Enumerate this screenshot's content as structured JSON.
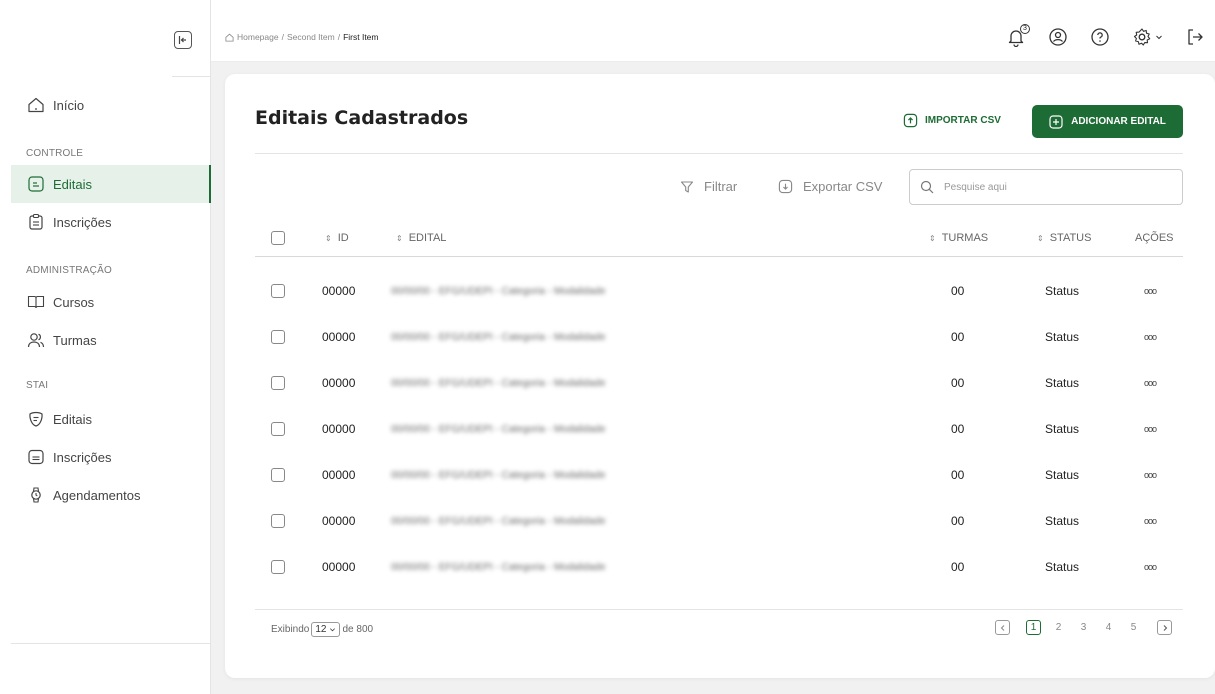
{
  "sidebar": {
    "items": [
      {
        "label": "Início",
        "icon": "home-icon"
      },
      {
        "label": "Editais",
        "icon": "document-icon",
        "active": true
      },
      {
        "label": "Inscrições",
        "icon": "clipboard-icon"
      },
      {
        "label": "Cursos",
        "icon": "book-icon"
      },
      {
        "label": "Turmas",
        "icon": "users-icon"
      },
      {
        "label": "Editais",
        "icon": "face-icon"
      },
      {
        "label": "Inscrições",
        "icon": "inbox-icon"
      },
      {
        "label": "Agendamentos",
        "icon": "watch-icon"
      }
    ],
    "sections": [
      "CONTROLE",
      "ADMINISTRAÇÃO",
      "STAI"
    ]
  },
  "breadcrumb": [
    "Homepage",
    "Second Item",
    "First Item"
  ],
  "notifications_count": "3",
  "page": {
    "title": "Editais Cadastrados",
    "import_label": "IMPORTAR CSV",
    "add_label": "ADICIONAR EDITAL",
    "filter_label": "Filtrar",
    "export_label": "Exportar CSV",
    "search_placeholder": "Pesquise aqui"
  },
  "table": {
    "headers": [
      "ID",
      "EDITAL",
      "TURMAS",
      "STATUS",
      "AÇÕES"
    ],
    "rows": [
      {
        "id": "00000",
        "edital": "00/00/00 - EFG/UDEPI - Categoria - Modalidade",
        "turmas": "00",
        "status": "Status"
      },
      {
        "id": "00000",
        "edital": "00/00/00 - EFG/UDEPI - Categoria - Modalidade",
        "turmas": "00",
        "status": "Status"
      },
      {
        "id": "00000",
        "edital": "00/00/00 - EFG/UDEPI - Categoria - Modalidade",
        "turmas": "00",
        "status": "Status"
      },
      {
        "id": "00000",
        "edital": "00/00/00 - EFG/UDEPI - Categoria - Modalidade",
        "turmas": "00",
        "status": "Status"
      },
      {
        "id": "00000",
        "edital": "00/00/00 - EFG/UDEPI - Categoria - Modalidade",
        "turmas": "00",
        "status": "Status"
      },
      {
        "id": "00000",
        "edital": "00/00/00 - EFG/UDEPI - Categoria - Modalidade",
        "turmas": "00",
        "status": "Status"
      },
      {
        "id": "00000",
        "edital": "00/00/00 - EFG/UDEPI - Categoria - Modalidade",
        "turmas": "00",
        "status": "Status"
      }
    ]
  },
  "pagination": {
    "showing_prefix": "Exibindo",
    "page_size": "12",
    "total_suffix": "de 800",
    "pages": [
      "1",
      "2",
      "3",
      "4",
      "5"
    ],
    "current_page": "1"
  },
  "colors": {
    "accent": "#1d6b35",
    "active_bg": "#e6f2e9"
  }
}
